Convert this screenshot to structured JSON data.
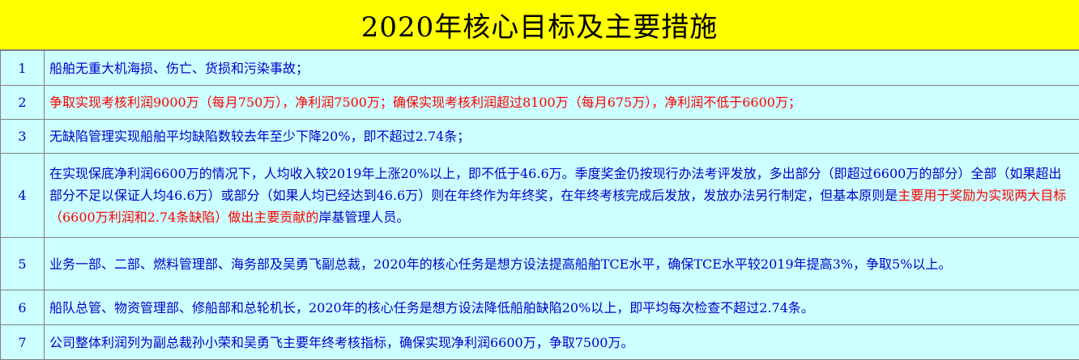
{
  "title": "2020年核心目标及主要措施",
  "colors": {
    "title_bg": "#ffff00",
    "row_bg": "#ccffff",
    "text_blue": "#0000cc",
    "text_red": "#ff0000",
    "grid": "#808080"
  },
  "rows": [
    {
      "num": "1",
      "text": "船舶无重大机海损、伤亡、货损和污染事故；"
    },
    {
      "num": "2",
      "text": "争取实现考核利润9000万（每月750万），净利润7500万；确保实现考核利润超过8100万（每月675万），净利润不低于6600万；"
    },
    {
      "num": "3",
      "text": "无缺陷管理实现船舶平均缺陷数较去年至少下降20%，即不超过2.74条；"
    },
    {
      "num": "4",
      "text_a": "在实现保底净利润6600万的情况下，人均收入较2019年上涨20%以上，即不低于46.6万。季度奖金仍按现行办法考评发放，多出部分（即超过6600万的部分）全部（如果超出部分不足以保证人均46.6万）或部分（如果人均已经达到46.6万）则在年终作为年终奖，在年终考核完成后发放，发放办法另行制定，但基本原则是",
      "text_b": "主要用于奖励为实现两大目标（6600万利润和2.74条缺陷）做出主要贡献的",
      "text_c": "岸基管理人员。"
    },
    {
      "num": "5",
      "text": "业务一部、二部、燃料管理部、海务部及吴勇飞副总裁，2020年的核心任务是想方设法提高船舶TCE水平，确保TCE水平较2019年提高3%，争取5%以上。"
    },
    {
      "num": "6",
      "text": "船队总管、物资管理部、修船部和总轮机长，2020年的核心任务是想方设法降低船舶缺陷20%以上，即平均每次检查不超过2.74条。"
    },
    {
      "num": "7",
      "text": "公司整体利润列为副总裁孙小荣和吴勇飞主要年终考核指标，确保实现净利润6600万，争取7500万。"
    }
  ]
}
